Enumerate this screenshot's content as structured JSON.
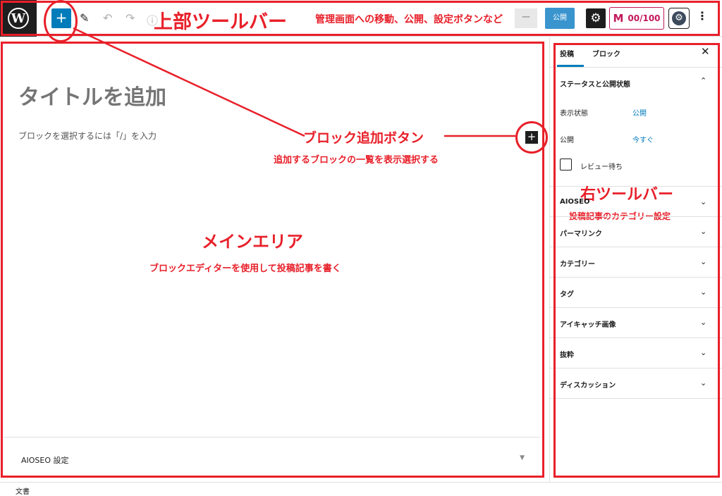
{
  "toolbar": {
    "logo": "W",
    "add_block": "+",
    "draft_btn": "ー",
    "publish_btn": "公開",
    "settings_icon": "gear-icon",
    "score": "00/100",
    "score_logo": "ꟿ",
    "more": "⋮"
  },
  "main": {
    "post_title": "タイトルを追加",
    "block_hint": "ブロックを選択するには「/」を入力",
    "inserter": "+",
    "aioseo_panel_label": "AIOSEO 設定",
    "aioseo_panel_arrow": "▼"
  },
  "sidebar": {
    "tab_post": "投稿",
    "tab_block": "ブロック",
    "close": "✕",
    "status_panel": "ステータスと公開状態",
    "visibility_label": "表示状態",
    "visibility_value": "公開",
    "publish_label": "公開",
    "publish_value": "今すぐ",
    "pending_review": "レビュー待ち",
    "panels": [
      "AIOSEO",
      "パーマリンク",
      "カテゴリー",
      "タグ",
      "アイキャッチ画像",
      "抜粋",
      "ディスカッション"
    ]
  },
  "footer": {
    "breadcrumb": "文書"
  },
  "annotations": {
    "top_toolbar_title": "上部ツールバー",
    "top_toolbar_note": "管理画面への移動、公開、設定ボタンなど",
    "block_add_title": "ブロック追加ボタン",
    "block_add_note": "追加するブロックの一覧を表示選択する",
    "main_area_title": "メインエリア",
    "main_area_note": "ブロックエディターを使用して投稿記事を書く",
    "right_toolbar_title": "右ツールバー",
    "right_toolbar_note": "投稿記事のカテゴリー設定"
  },
  "colors": {
    "annotation_red": "#e8202a",
    "wp_blue": "#007cba",
    "aioseo_pink": "#c2185b",
    "dark": "#1e1e1e"
  }
}
